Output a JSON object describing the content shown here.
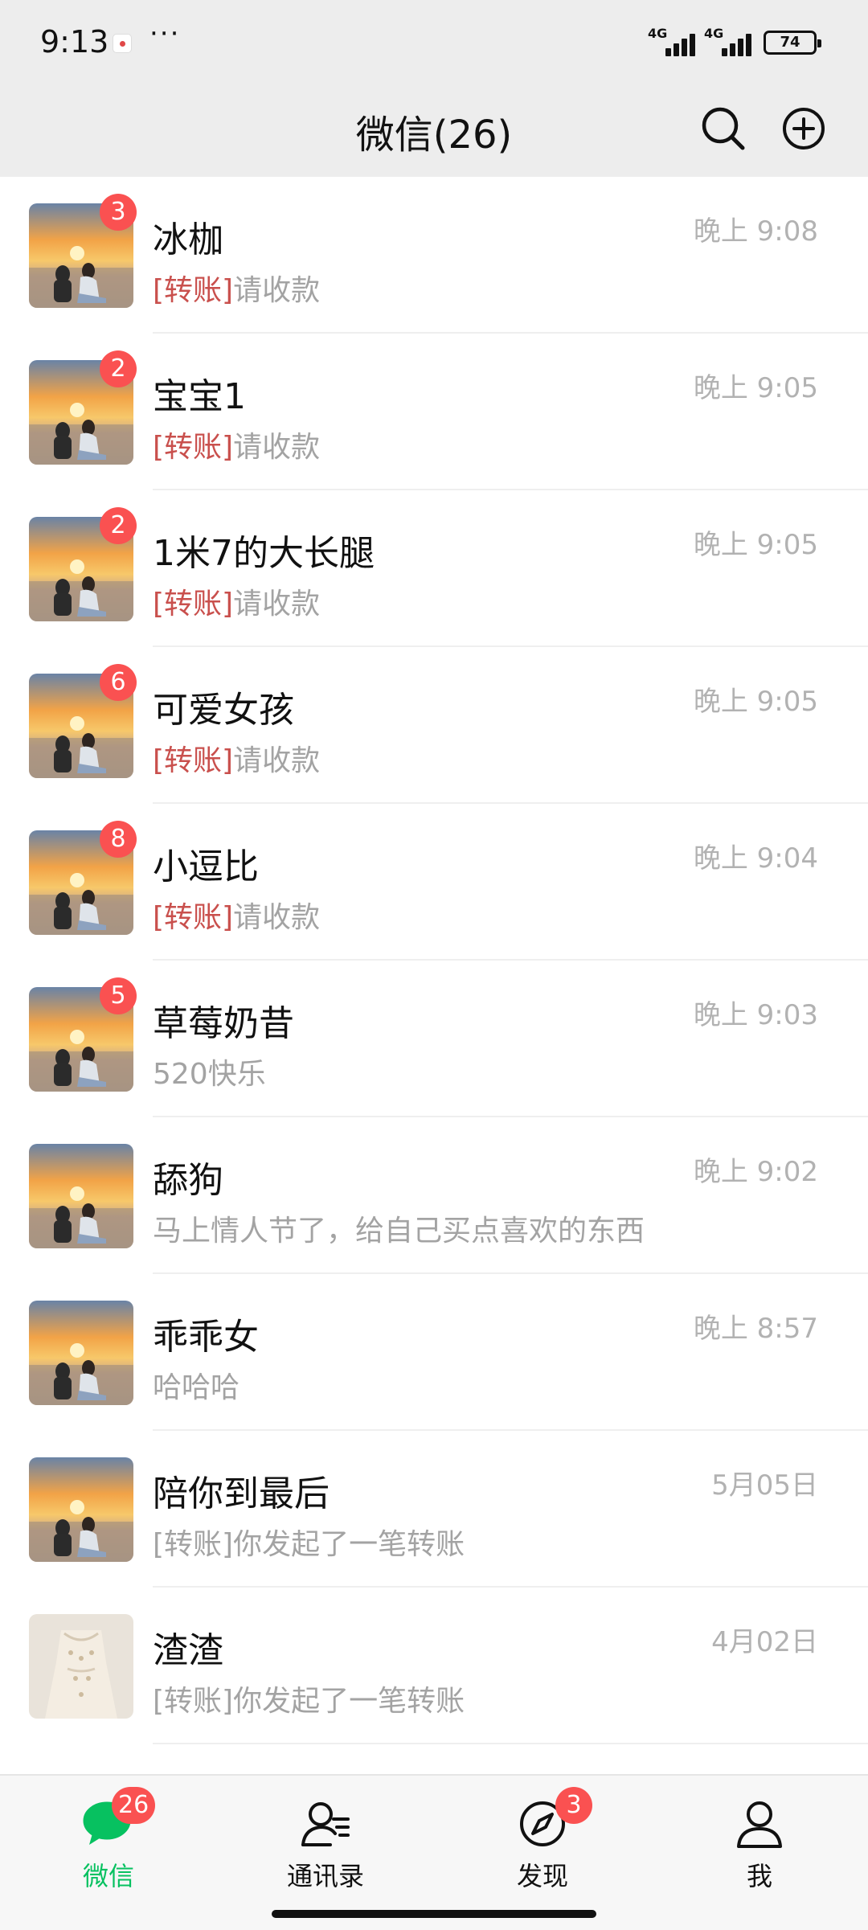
{
  "status_bar": {
    "time": "9:13",
    "overflow": "···",
    "network1": "4G",
    "network2": "4G",
    "battery": "74"
  },
  "header": {
    "title": "微信(26)",
    "search_icon": "search-icon",
    "add_icon": "plus-circle-icon"
  },
  "colors": {
    "badge": "#fa5151",
    "accent_green": "#07c160",
    "transfer_tag": "#c9504d"
  },
  "chats": [
    {
      "name": "冰枷",
      "tag": "[转账]",
      "preview": "请收款",
      "time": "晚上 9:08",
      "badge": "3",
      "avatar": "sunset"
    },
    {
      "name": "宝宝1",
      "tag": "[转账]",
      "preview": "请收款",
      "time": "晚上 9:05",
      "badge": "2",
      "avatar": "sunset"
    },
    {
      "name": "1米7的大长腿",
      "tag": "[转账]",
      "preview": "请收款",
      "time": "晚上 9:05",
      "badge": "2",
      "avatar": "sunset"
    },
    {
      "name": "可爱女孩",
      "tag": "[转账]",
      "preview": "请收款",
      "time": "晚上 9:05",
      "badge": "6",
      "avatar": "sunset"
    },
    {
      "name": "小逗比",
      "tag": "[转账]",
      "preview": "请收款",
      "time": "晚上 9:04",
      "badge": "8",
      "avatar": "sunset"
    },
    {
      "name": "草莓奶昔",
      "tag": "",
      "preview": "520快乐",
      "time": "晚上 9:03",
      "badge": "5",
      "avatar": "sunset"
    },
    {
      "name": "舔狗",
      "tag": "",
      "preview": "马上情人节了，给自己买点喜欢的东西",
      "time": "晚上 9:02",
      "badge": "",
      "avatar": "sunset"
    },
    {
      "name": "乖乖女",
      "tag": "",
      "preview": "哈哈哈",
      "time": "晚上 8:57",
      "badge": "",
      "avatar": "sunset"
    },
    {
      "name": "陪你到最后",
      "tag": "",
      "preview": "[转账]你发起了一笔转账",
      "time": "5月05日",
      "badge": "",
      "avatar": "sunset"
    },
    {
      "name": "渣渣",
      "tag": "",
      "preview": "[转账]你发起了一笔转账",
      "time": "4月02日",
      "badge": "",
      "avatar": "dress"
    }
  ],
  "tabs": [
    {
      "label": "微信",
      "badge": "26",
      "icon": "chat-bubble-icon",
      "active": true
    },
    {
      "label": "通讯录",
      "badge": "",
      "icon": "contacts-icon",
      "active": false
    },
    {
      "label": "发现",
      "badge": "3",
      "icon": "compass-icon",
      "active": false
    },
    {
      "label": "我",
      "badge": "",
      "icon": "person-icon",
      "active": false
    }
  ]
}
